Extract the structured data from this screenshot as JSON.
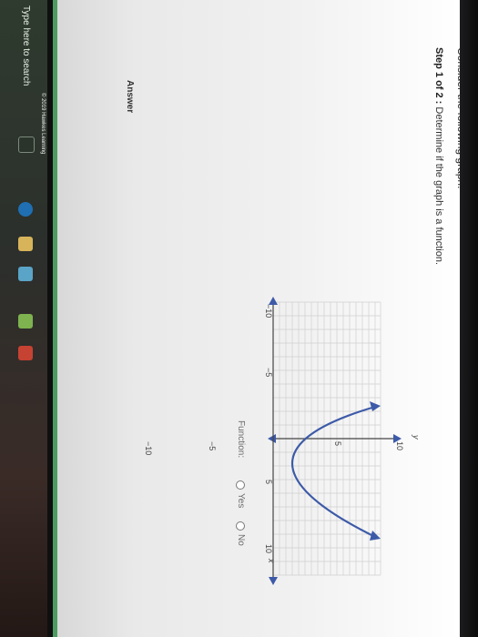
{
  "taskbar": {
    "search_text": "Type here to search"
  },
  "copyright": "© 2019 Hawkes Learning",
  "problem": {
    "title": "Consider the following graph.",
    "step_label": "Step 1 of 2 :",
    "step_text": " Determine if the graph is a function."
  },
  "graph": {
    "x_axis_label": "x",
    "y_axis_label": "y",
    "ticks": {
      "x_neg10": "−10",
      "x_neg5": "−5",
      "x_5": "5",
      "x_10": "10",
      "y_10": "10",
      "y_5": "5",
      "y_neg5": "−5",
      "y_neg10": "−10"
    },
    "curve_color": "#3d5aa8"
  },
  "answer": {
    "label": "Answer",
    "question": "Function:",
    "option_yes": "Yes",
    "option_no": "No"
  }
}
